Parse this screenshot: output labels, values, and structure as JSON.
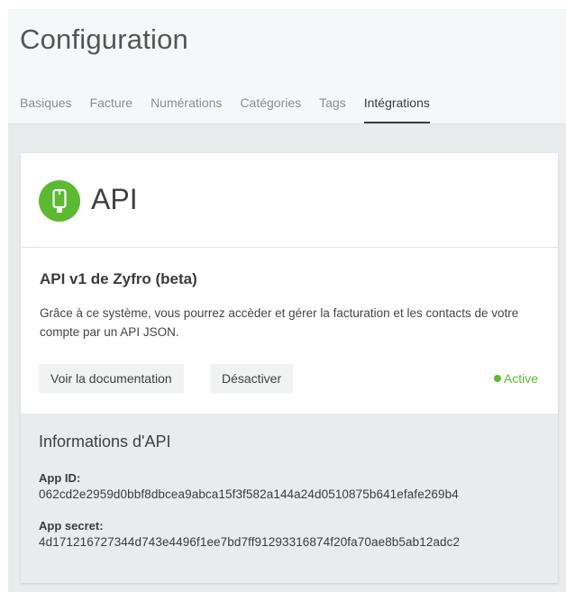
{
  "header": {
    "title": "Configuration",
    "tabs": [
      {
        "label": "Basiques",
        "active": false
      },
      {
        "label": "Facture",
        "active": false
      },
      {
        "label": "Numérations",
        "active": false
      },
      {
        "label": "Catégories",
        "active": false
      },
      {
        "label": "Tags",
        "active": false
      },
      {
        "label": "Intégrations",
        "active": true
      }
    ]
  },
  "card": {
    "logo_icon": "phone-icon",
    "title": "API",
    "section_title": "API v1 de Zyfro (beta)",
    "description": "Grâce à ce système, vous pourrez accèder et gérer la facturation et les contacts de votre compte par un API JSON.",
    "buttons": {
      "docs_label": "Voir la documentation",
      "deactivate_label": "Désactiver"
    },
    "status": {
      "label": "Active",
      "color": "#5cb932"
    }
  },
  "info": {
    "title": "Informations d'API",
    "app_id_label": "App ID:",
    "app_id_value": "062cd2e2959d0bbf8dbcea9abca15f3f582a144a24d0510875b641efafe269b4",
    "app_secret_label": "App secret:",
    "app_secret_value": "4d171216727344d743e4496f1ee7bd7ff91293316874f20fa70ae8b5ab12adc2"
  },
  "colors": {
    "accent": "#5cb932",
    "page_bg": "#e9ecec",
    "header_bg": "#f5f8f8"
  }
}
